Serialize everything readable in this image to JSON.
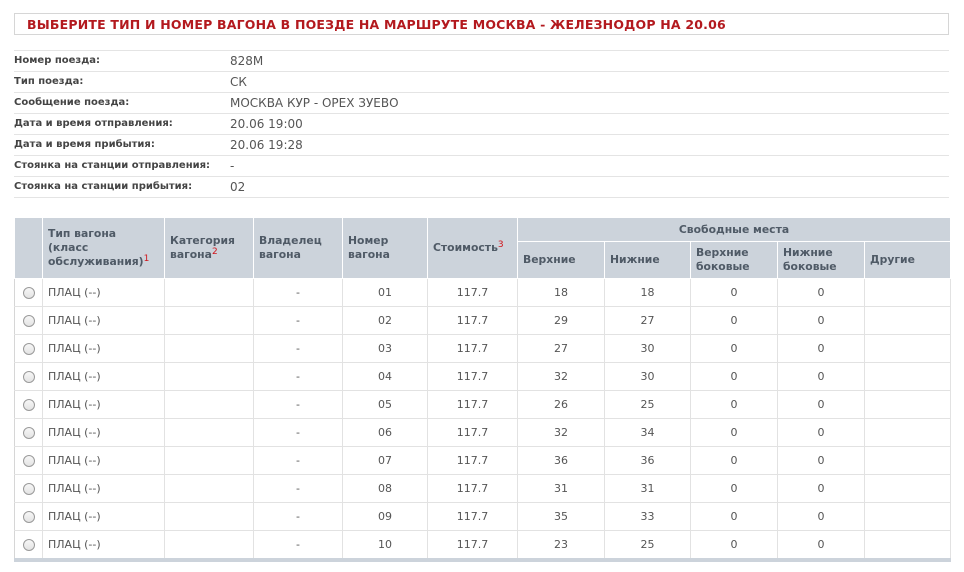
{
  "page": {
    "title": "ВЫБЕРИТЕ ТИП И НОМЕР ВАГОНА В ПОЕЗДЕ НА МАРШРУТЕ МОСКВА - ЖЕЛЕЗНОДОР НА 20.06"
  },
  "train_info": {
    "train_number_label": "Номер поезда:",
    "train_number": "828М",
    "train_type_label": "Тип поезда:",
    "train_type": "СК",
    "route_label": "Сообщение поезда:",
    "route": "МОСКВА КУР - ОРЕХ ЗУЕВО",
    "departure_label": "Дата и время отправления:",
    "departure": "20.06 19:00",
    "arrival_label": "Дата и время прибытия:",
    "arrival": "20.06 19:28",
    "stop_departure_label": "Стоянка на станции отправления:",
    "stop_departure": "-",
    "stop_arrival_label": "Стоянка на станции прибытия:",
    "stop_arrival": "02"
  },
  "table": {
    "headers": {
      "wagon_type": "Тип вагона (класс обслуживания)",
      "wagon_type_fn": "1",
      "category": "Категория вагона",
      "category_fn": "2",
      "owner": "Владелец вагона",
      "number": "Номер вагона",
      "price": "Стоимость",
      "price_fn": "3",
      "free_seats": "Свободные места",
      "upper": "Верхние",
      "lower": "Нижние",
      "upper_side": "Верхние боковые",
      "lower_side": "Нижние боковые",
      "other": "Другие"
    },
    "rows": [
      {
        "type": "ПЛАЦ (--)",
        "category": "",
        "owner": "-",
        "number": "01",
        "price": "117.7",
        "upper": "18",
        "lower": "18",
        "upper_side": "0",
        "lower_side": "0",
        "other": ""
      },
      {
        "type": "ПЛАЦ (--)",
        "category": "",
        "owner": "-",
        "number": "02",
        "price": "117.7",
        "upper": "29",
        "lower": "27",
        "upper_side": "0",
        "lower_side": "0",
        "other": ""
      },
      {
        "type": "ПЛАЦ (--)",
        "category": "",
        "owner": "-",
        "number": "03",
        "price": "117.7",
        "upper": "27",
        "lower": "30",
        "upper_side": "0",
        "lower_side": "0",
        "other": ""
      },
      {
        "type": "ПЛАЦ (--)",
        "category": "",
        "owner": "-",
        "number": "04",
        "price": "117.7",
        "upper": "32",
        "lower": "30",
        "upper_side": "0",
        "lower_side": "0",
        "other": ""
      },
      {
        "type": "ПЛАЦ (--)",
        "category": "",
        "owner": "-",
        "number": "05",
        "price": "117.7",
        "upper": "26",
        "lower": "25",
        "upper_side": "0",
        "lower_side": "0",
        "other": ""
      },
      {
        "type": "ПЛАЦ (--)",
        "category": "",
        "owner": "-",
        "number": "06",
        "price": "117.7",
        "upper": "32",
        "lower": "34",
        "upper_side": "0",
        "lower_side": "0",
        "other": ""
      },
      {
        "type": "ПЛАЦ (--)",
        "category": "",
        "owner": "-",
        "number": "07",
        "price": "117.7",
        "upper": "36",
        "lower": "36",
        "upper_side": "0",
        "lower_side": "0",
        "other": ""
      },
      {
        "type": "ПЛАЦ (--)",
        "category": "",
        "owner": "-",
        "number": "08",
        "price": "117.7",
        "upper": "31",
        "lower": "31",
        "upper_side": "0",
        "lower_side": "0",
        "other": ""
      },
      {
        "type": "ПЛАЦ (--)",
        "category": "",
        "owner": "-",
        "number": "09",
        "price": "117.7",
        "upper": "35",
        "lower": "33",
        "upper_side": "0",
        "lower_side": "0",
        "other": ""
      },
      {
        "type": "ПЛАЦ (--)",
        "category": "",
        "owner": "-",
        "number": "10",
        "price": "117.7",
        "upper": "23",
        "lower": "25",
        "upper_side": "0",
        "lower_side": "0",
        "other": ""
      }
    ]
  },
  "colors": {
    "title_red": "#b3191e",
    "header_bg": "#ccd3db",
    "footnote_red": "#d0141a"
  }
}
